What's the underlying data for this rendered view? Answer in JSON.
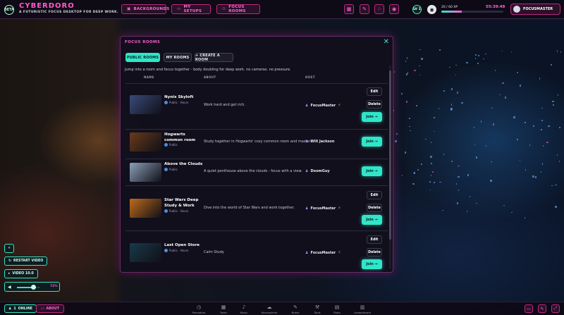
{
  "app": {
    "badge": "BETA",
    "title": "CYBERDORO",
    "subtitle": "A FUTURISTIC FOCUS DESKTOP FOR DEEP WORK."
  },
  "nav": {
    "backgrounds": {
      "icon": "image-icon",
      "label": "BACKGROUNDS"
    },
    "my_setups": {
      "icon": "folder-icon",
      "label": "MY SETUPS"
    },
    "focus_rooms": {
      "icon": "people-icon",
      "label": "FOCUS ROOMS"
    }
  },
  "toolbar": {
    "icons": [
      "grid-icon",
      "pen-icon",
      "apps-icon",
      "spotify-icon"
    ]
  },
  "status": {
    "level_badge": "LV 1",
    "progress_label": "20 / 60 XP",
    "progress_fraction": 0.33,
    "timer": "55:39:49"
  },
  "profile": {
    "name": "FOCUSMASTER"
  },
  "modal": {
    "title": "FOCUS ROOMS",
    "close": "✕",
    "tabs": {
      "public": "PUBLIC ROOMS",
      "mine": "MY ROOMS",
      "create": "+ CREATE A ROOM"
    },
    "intro": "Jump into a room and focus together - body doubling for deep work. no cameras. no pressure.",
    "columns": {
      "name": "NAME",
      "about": "ABOUT",
      "host": "HOST"
    },
    "rooms": [
      {
        "name": "Nynix Skyloft",
        "meta": "Public · Hours",
        "about": "Work hard and get rich.",
        "host": "FocusMaster",
        "edit": "Edit",
        "delete": "Delete",
        "join": "Join →",
        "thumb_color": "#3a4a7a"
      },
      {
        "name": "Hogwarts common room",
        "meta": "Public",
        "about": "Study together in Hogwarts' cozy common room and master...",
        "host": "Will Jackson",
        "join": "Join →",
        "thumb_color": "#6a3a1a"
      },
      {
        "name": "Above the Clouds",
        "meta": "Public",
        "about": "A quiet penthouse above the clouds - focus with a view.",
        "host": "DoomGuy",
        "join": "Join →",
        "thumb_color": "#8aa0b8"
      },
      {
        "name": "Star Wars Deep Study & Work",
        "meta": "Public · Hours",
        "about": "Dive into the world of Star Wars and work together.",
        "host": "FocusMaster",
        "edit": "Edit",
        "delete": "Delete",
        "join": "Join →",
        "thumb_color": "#c06a1a"
      },
      {
        "name": "Last Open Store",
        "meta": "Public · Hours",
        "about": "Calm Study",
        "host": "FocusMaster",
        "edit": "Edit",
        "delete": "Delete",
        "join": "Join →",
        "thumb_color": "#1a3a4a"
      }
    ]
  },
  "left_controls": {
    "collapse": "«",
    "restart_video": "RESTART VIDEO",
    "video_quality": "VIDEO 10.0",
    "volume_percent": 72,
    "volume_label": "72%"
  },
  "bottom": {
    "online_count": "1",
    "online_label": "ONLINE",
    "about_label": "ABOUT",
    "dock": [
      {
        "icon": "clock-icon",
        "glyph": "◷",
        "label": "Pomodoro"
      },
      {
        "icon": "tasks-icon",
        "glyph": "▦",
        "label": "Tasks"
      },
      {
        "icon": "music-icon",
        "glyph": "♪",
        "label": "Music"
      },
      {
        "icon": "cloud-icon",
        "glyph": "☁",
        "label": "Atmosphere"
      },
      {
        "icon": "notes-icon",
        "glyph": "✎",
        "label": "Notes"
      },
      {
        "icon": "tools-icon",
        "glyph": "⚒",
        "label": "Tools"
      },
      {
        "icon": "stats-icon",
        "glyph": "▤",
        "label": "Stats"
      },
      {
        "icon": "leaderboard-icon",
        "glyph": "▥",
        "label": "Leaderboard"
      }
    ]
  }
}
